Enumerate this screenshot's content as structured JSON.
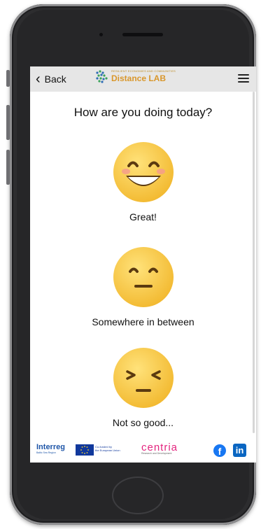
{
  "header": {
    "back_label": "Back",
    "logo_small_text": "RESILIENT ECONOMIES AND COMMUNITIES",
    "logo_title": "Distance LAB",
    "back_icon": "chevron-left-icon",
    "menu_icon": "hamburger-menu-icon"
  },
  "main": {
    "question": "How are you doing today?",
    "options": [
      {
        "label": "Great!",
        "icon": "grinning-face-icon"
      },
      {
        "label": "Somewhere in between",
        "icon": "neutral-face-icon"
      },
      {
        "label": "Not so good...",
        "icon": "sad-face-icon"
      }
    ]
  },
  "footer": {
    "interreg": "Interreg",
    "interreg_sub": "Baltic Sea Region",
    "eu_line1": "Co-funded by",
    "eu_line2": "the European Union",
    "centria": "centria",
    "centria_sub": "Research and Development",
    "facebook_icon": "f",
    "linkedin_icon": "in"
  },
  "colors": {
    "header_bg": "#e6e6e6",
    "emoji_yellow": "#f5c33b",
    "logo_orange": "#d9972c",
    "centria_pink": "#e4257f"
  }
}
